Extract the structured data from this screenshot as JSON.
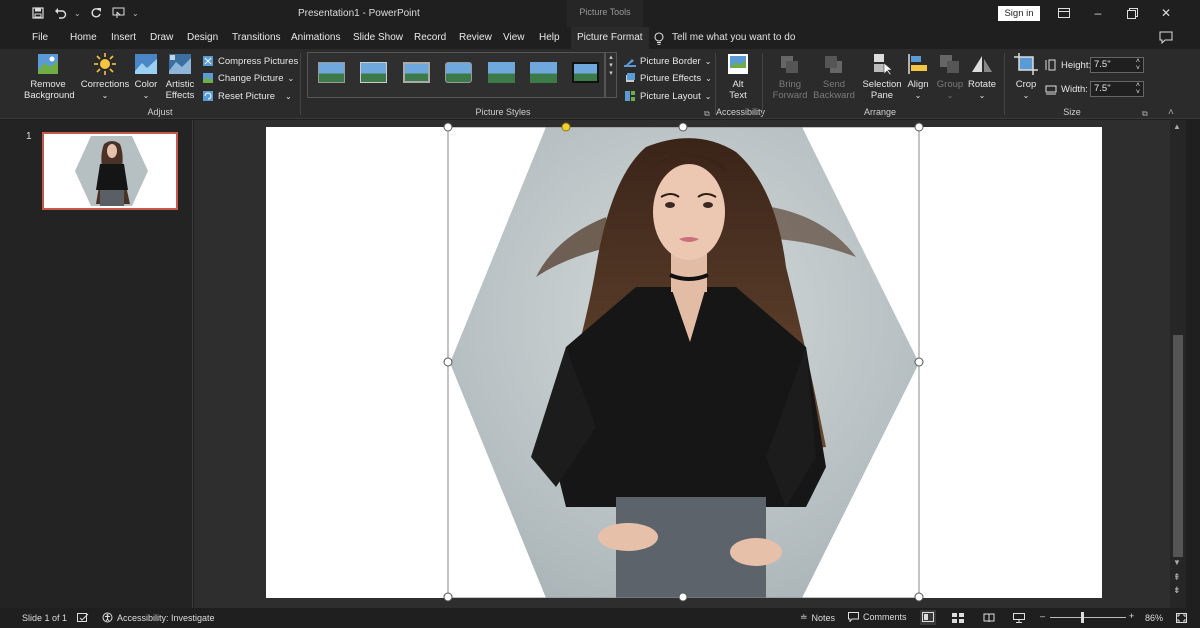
{
  "titlebar": {
    "doc_title": "Presentation1 - PowerPoint",
    "context_label": "Picture Tools",
    "signin_label": "Sign in",
    "qat_icons": [
      "save-icon",
      "undo-icon",
      "redo-icon",
      "touch-mode-icon",
      "customize-icon"
    ]
  },
  "tabs": {
    "items": [
      "File",
      "Home",
      "Insert",
      "Draw",
      "Design",
      "Transitions",
      "Animations",
      "Slide Show",
      "Record",
      "Review",
      "View",
      "Help"
    ],
    "active": "Picture Format",
    "tellme": "Tell me what you want to do"
  },
  "ribbon": {
    "adjust": {
      "remove_bg": "Remove\nBackground",
      "remove_bg_l1": "Remove",
      "remove_bg_l2": "Background",
      "corrections": "Corrections",
      "color": "Color",
      "artistic_l1": "Artistic",
      "artistic_l2": "Effects",
      "compress": "Compress Pictures",
      "change": "Change Picture",
      "reset": "Reset Picture",
      "label": "Adjust"
    },
    "styles": {
      "border": "Picture Border",
      "effects": "Picture Effects",
      "layout": "Picture Layout",
      "label": "Picture Styles"
    },
    "accessibility": {
      "alt_l1": "Alt",
      "alt_l2": "Text",
      "label": "Accessibility"
    },
    "arrange": {
      "bring_l1": "Bring",
      "bring_l2": "Forward",
      "send_l1": "Send",
      "send_l2": "Backward",
      "selection_l1": "Selection",
      "selection_l2": "Pane",
      "align": "Align",
      "group": "Group",
      "rotate": "Rotate",
      "label": "Arrange"
    },
    "size": {
      "crop": "Crop",
      "height_label": "Height:",
      "height_value": "7.5\"",
      "width_label": "Width:",
      "width_value": "7.5\"",
      "label": "Size"
    }
  },
  "slides": {
    "number": "1"
  },
  "status": {
    "slide_info": "Slide 1 of 1",
    "accessibility": "Accessibility: Investigate",
    "notes": "Notes",
    "comments": "Comments",
    "zoom": "86%"
  },
  "colors": {
    "accent": "#c55a4a",
    "ribbon_bg": "#2b2b2b",
    "handle_yellow": "#f2d230"
  }
}
